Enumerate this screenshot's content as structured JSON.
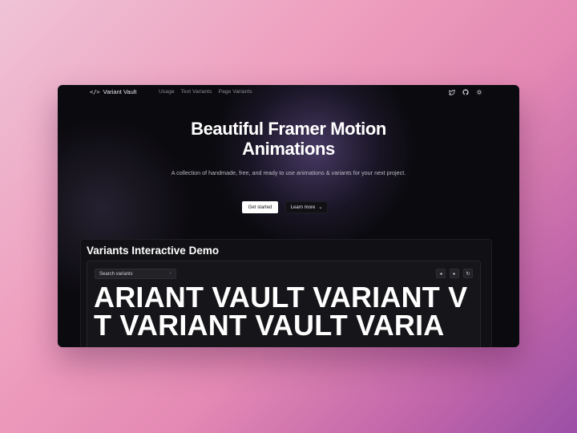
{
  "nav": {
    "brand_icon": "</>",
    "brand": "Variant Vault",
    "links": [
      "Usage",
      "Text Variants",
      "Page Variants"
    ],
    "icons": [
      "twitter-icon",
      "github-icon",
      "theme-toggle-icon"
    ]
  },
  "hero": {
    "title_line1": "Beautiful Framer Motion",
    "title_line2": "Animations",
    "subtitle": "A collection of handmade, free, and ready to use animations & variants for your next project.",
    "primary_button": "Get started",
    "secondary_button": "Learn more",
    "secondary_chevron": "⌄"
  },
  "demo": {
    "title": "Variants Interactive Demo",
    "search_placeholder": "Search variants",
    "search_chevron": "↕",
    "prev": "◂",
    "next": "▸",
    "refresh": "↻",
    "row1": "ARIANT VAULT VARIANT V",
    "row2": "T VARIANT VAULT VARIA"
  },
  "colors": {
    "window_bg": "#0b0a0e",
    "accent_glow": "#7860aa",
    "text_primary": "#ffffff",
    "text_muted": "#8c8a94",
    "background_gradient": [
      "#efc3d6",
      "#e489b4",
      "#9a4fa6"
    ]
  }
}
